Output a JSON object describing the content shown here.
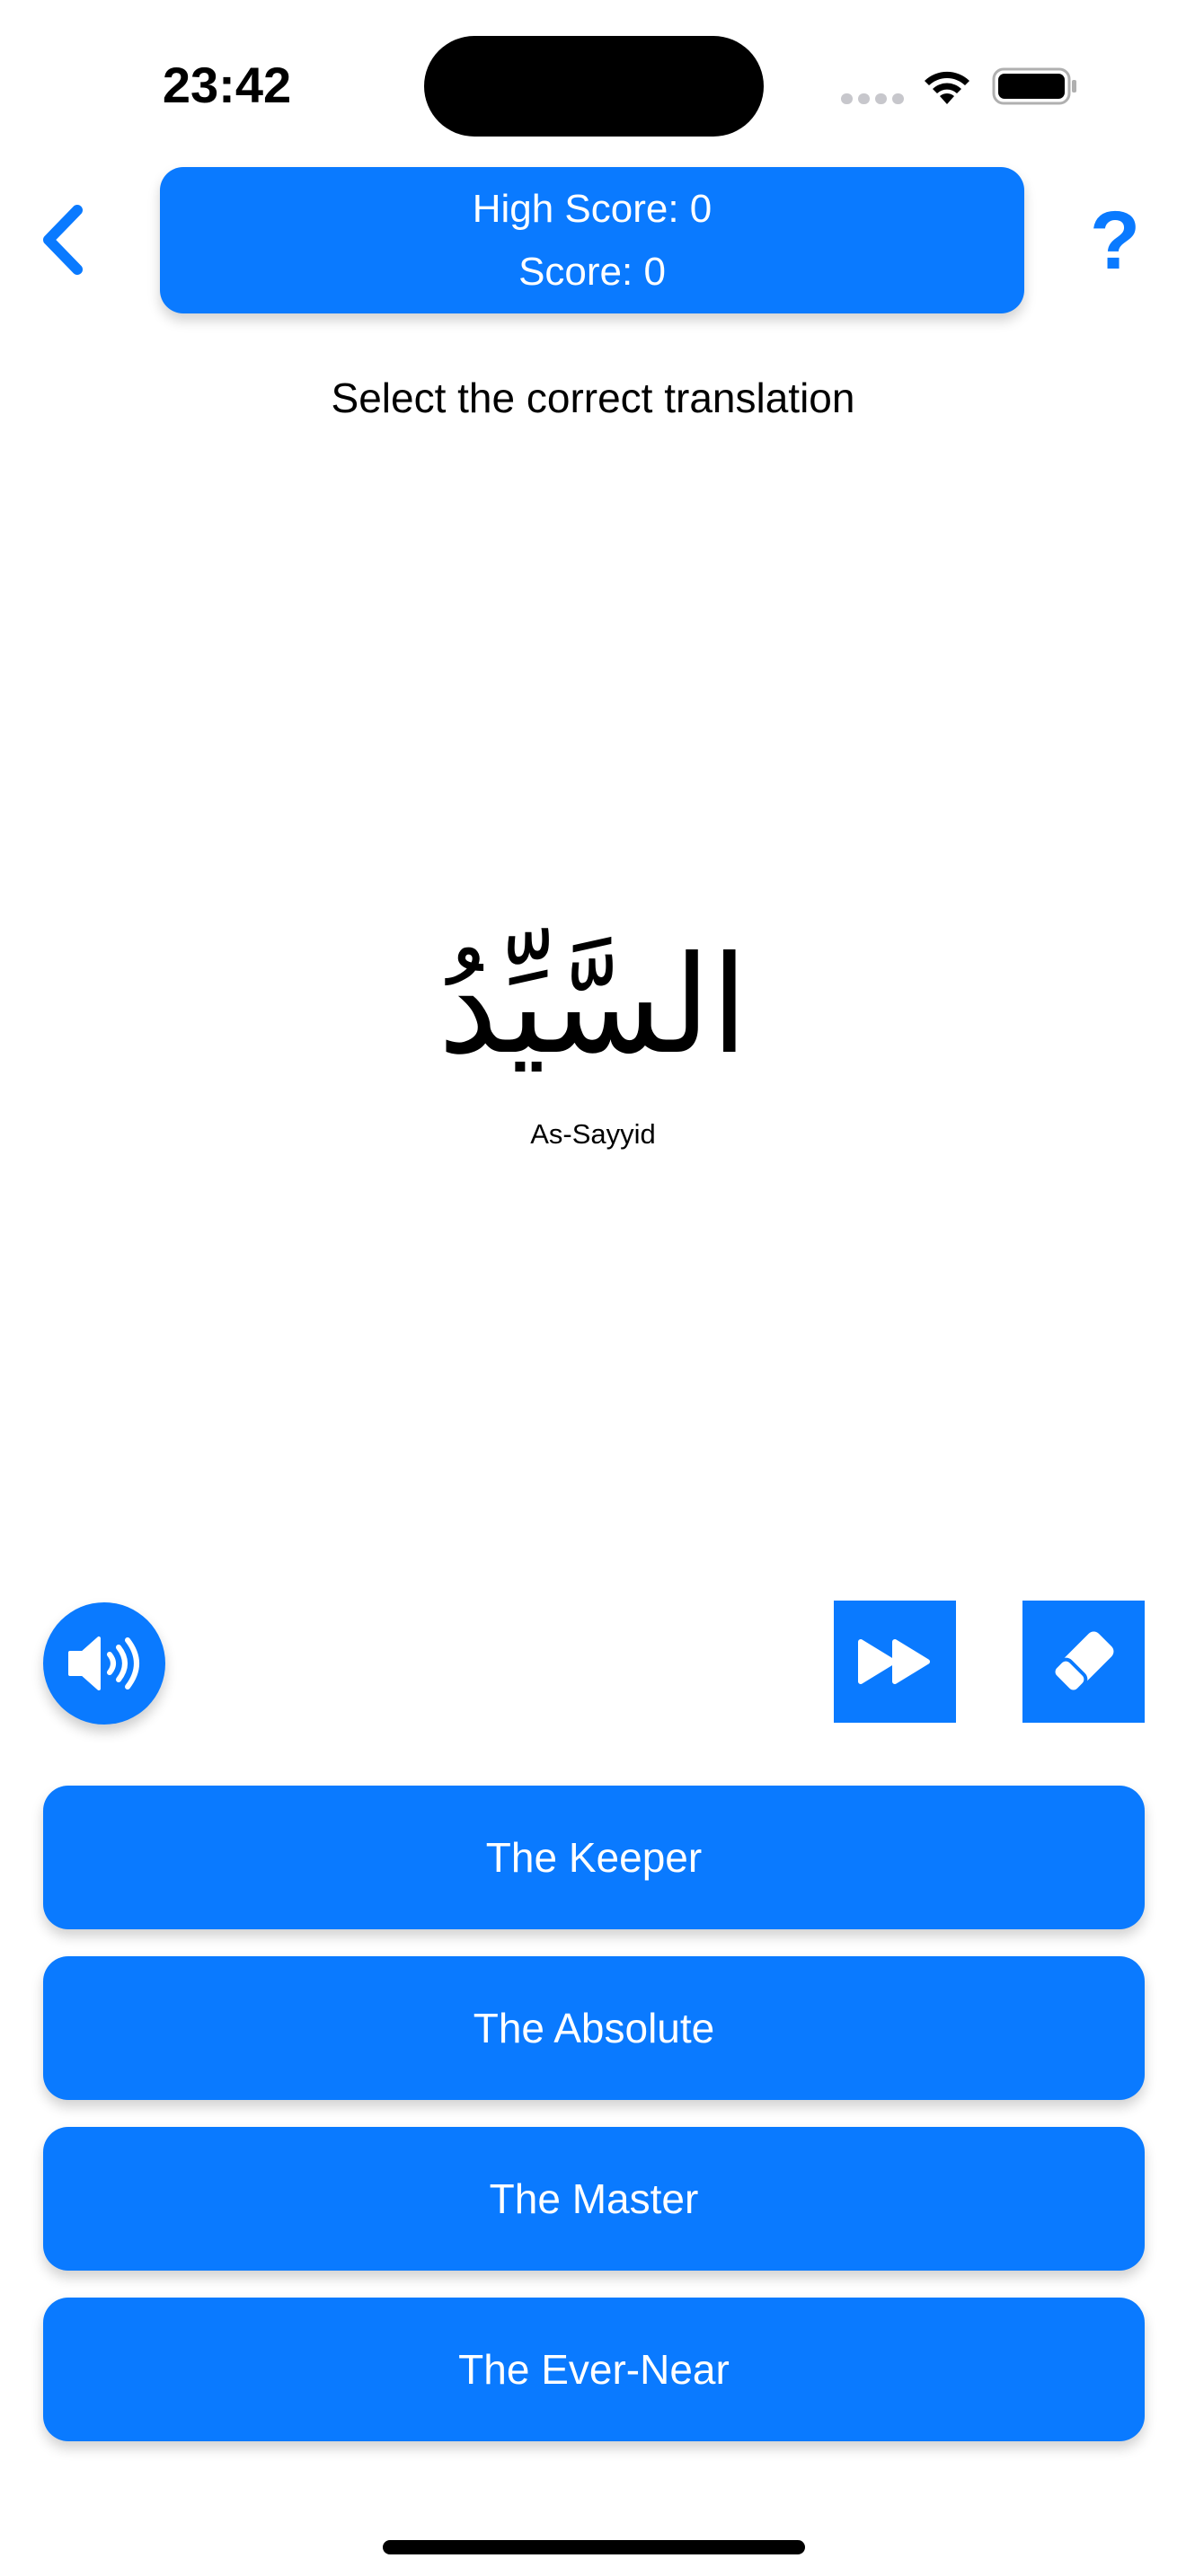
{
  "status_bar": {
    "time": "23:42"
  },
  "header": {
    "high_score_label": "High Score: 0",
    "score_label": "Score: 0"
  },
  "instruction": "Select the correct translation",
  "word": {
    "arabic": "السَّيِّدُ",
    "transliteration": "As-Sayyid"
  },
  "controls": {
    "audio_icon": "speaker-wave-icon",
    "skip_icon": "fast-forward-icon",
    "erase_icon": "eraser-icon"
  },
  "answers": [
    {
      "label": "The Keeper"
    },
    {
      "label": "The Absolute"
    },
    {
      "label": "The Master"
    },
    {
      "label": "The Ever-Near"
    }
  ],
  "colors": {
    "accent": "#0a7aff",
    "text": "#000000",
    "background": "#ffffff"
  }
}
